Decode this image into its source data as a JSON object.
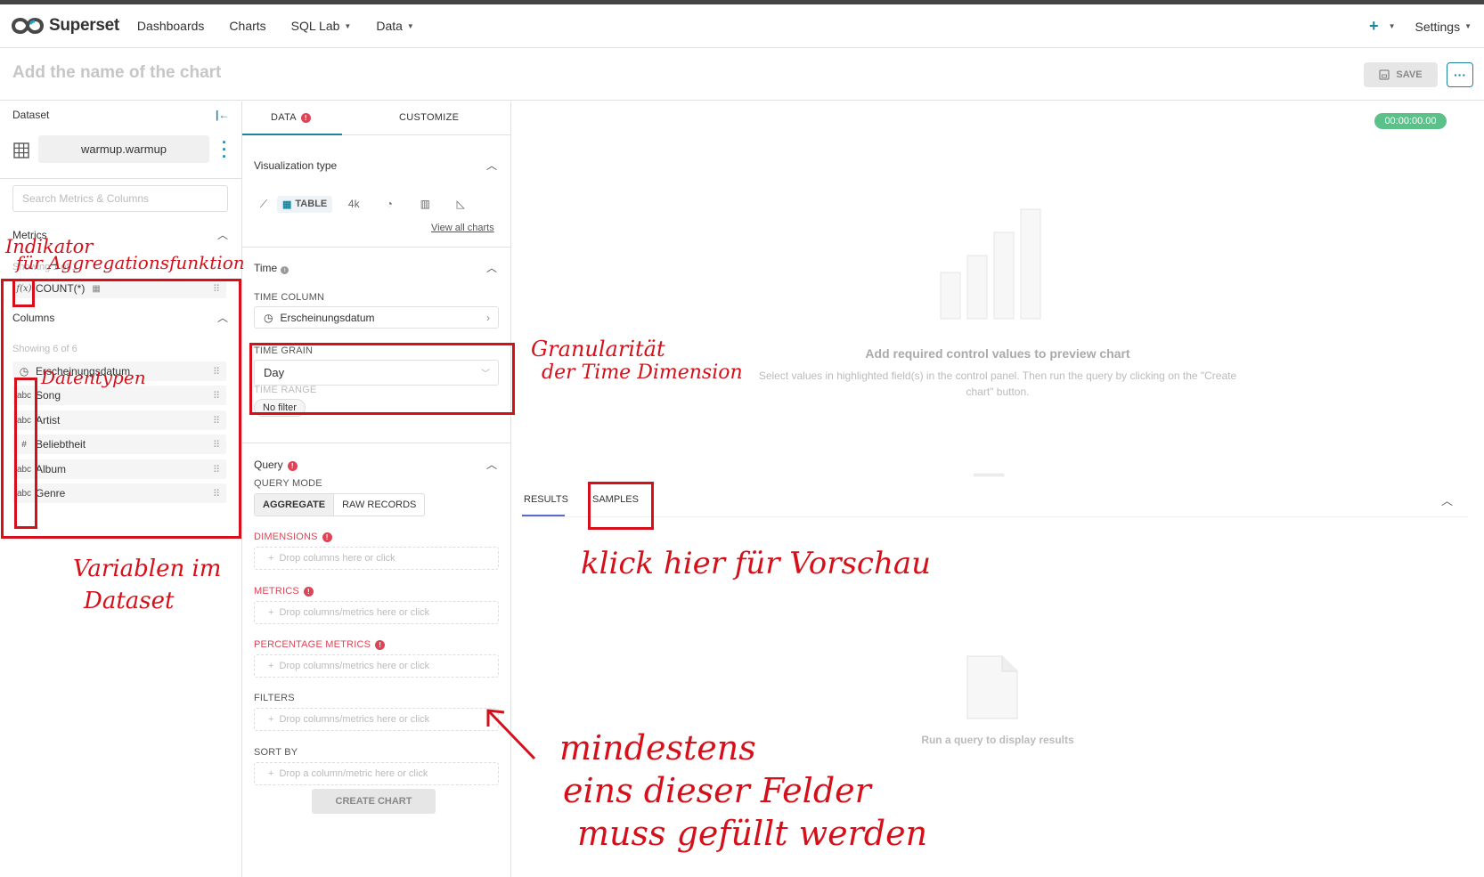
{
  "navbar": {
    "brand": "Superset",
    "items": [
      {
        "label": "Dashboards",
        "caret": false
      },
      {
        "label": "Charts",
        "caret": false
      },
      {
        "label": "SQL Lab",
        "caret": true
      },
      {
        "label": "Data",
        "caret": true
      }
    ],
    "settings_label": "Settings",
    "plus_icon": "plus-icon"
  },
  "chart_header": {
    "title_placeholder": "Add the name of the chart",
    "save_label": "SAVE",
    "more_label": "···"
  },
  "dataset_panel": {
    "label": "Dataset",
    "name": "warmup.warmup",
    "search_placeholder": "Search Metrics & Columns",
    "metrics_title": "Metrics",
    "metrics_showing": "Showing 1 of 1",
    "metrics": [
      {
        "type": "f(x)",
        "name": "COUNT(*)"
      }
    ],
    "columns_title": "Columns",
    "columns_showing": "Showing 6 of 6",
    "columns": [
      {
        "type": "clock",
        "type_label": "◷",
        "name": "Erscheinungsdatum"
      },
      {
        "type": "abc",
        "type_label": "abc",
        "name": "Song"
      },
      {
        "type": "abc",
        "type_label": "abc",
        "name": "Artist"
      },
      {
        "type": "num",
        "type_label": "#",
        "name": "Beliebtheit"
      },
      {
        "type": "abc",
        "type_label": "abc",
        "name": "Album"
      },
      {
        "type": "abc",
        "type_label": "abc",
        "name": "Genre"
      }
    ]
  },
  "control_panel": {
    "tab_data": "DATA",
    "tab_customize": "CUSTOMIZE",
    "viz_type_title": "Visualization type",
    "viz_table_label": "TABLE",
    "viz_bignumber_label": "4k",
    "view_all_label": "View all charts",
    "time_title": "Time",
    "time_column_label": "TIME COLUMN",
    "time_column_value": "Erscheinungsdatum",
    "time_grain_label": "TIME GRAIN",
    "time_grain_value": "Day",
    "time_range_label": "TIME RANGE",
    "time_range_value": "No filter",
    "query_title": "Query",
    "query_mode_label": "QUERY MODE",
    "query_mode_aggregate": "AGGREGATE",
    "query_mode_raw": "RAW RECORDS",
    "dimensions_label": "DIMENSIONS",
    "dimensions_placeholder": "Drop columns here or click",
    "metrics_label": "METRICS",
    "metrics_placeholder": "Drop columns/metrics here or click",
    "percentage_label": "PERCENTAGE METRICS",
    "percentage_placeholder": "Drop columns/metrics here or click",
    "filters_label": "FILTERS",
    "filters_placeholder": "Drop columns/metrics here or click",
    "sortby_label": "SORT BY",
    "sortby_placeholder": "Drop a column/metric here or click",
    "create_chart_label": "CREATE CHART"
  },
  "preview": {
    "timer": "00:00:00.00",
    "required_title": "Add required control values to preview chart",
    "required_sub": "Select values in highlighted field(s) in the control panel. Then run the query by clicking on the \"Create chart\" button.",
    "tab_results": "RESULTS",
    "tab_samples": "SAMPLES",
    "run_query_text": "Run a query to display results"
  },
  "annotations": {
    "aggregation": [
      "Indikator",
      "für Aggregationsfunktion"
    ],
    "datatypes": "Datentypen",
    "variables": [
      "Variablen im",
      "Dataset"
    ],
    "granularity": [
      "Granularität",
      "der Time Dimension"
    ],
    "preview_hint": "klick hier für Vorschau",
    "required_hint": [
      "mindestens",
      "eins dieser Felder",
      "muss gefüllt werden"
    ]
  },
  "colors": {
    "accent": "#1a85a0",
    "error": "#e04355",
    "timer": "#5ac189",
    "annotation": "#d6101a"
  }
}
